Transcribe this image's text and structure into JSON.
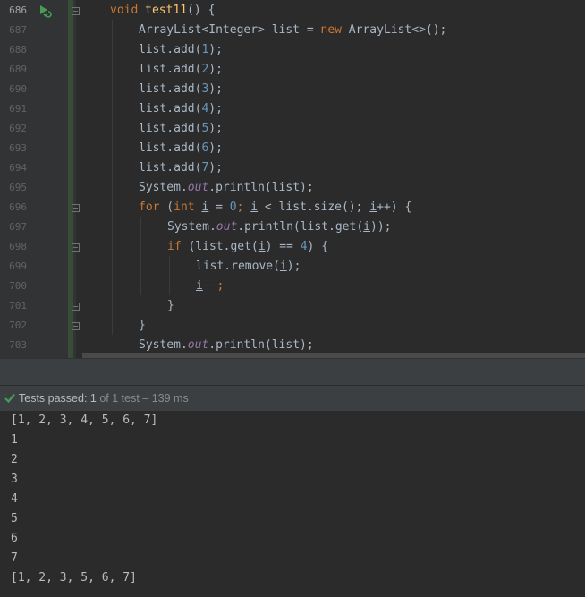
{
  "editor": {
    "line_numbers": [
      "686",
      "687",
      "688",
      "689",
      "690",
      "691",
      "692",
      "693",
      "694",
      "695",
      "696",
      "697",
      "698",
      "699",
      "700",
      "701",
      "702",
      "703"
    ],
    "code": {
      "l686": {
        "void": "void",
        "name": "test11",
        "rest": "() {"
      },
      "l687": {
        "type": "ArrayList<Integer> list = ",
        "new": "new",
        "rest": " ArrayList<>();"
      },
      "l688": {
        "pre": "list.add(",
        "n": "1",
        "post": ");"
      },
      "l689": {
        "pre": "list.add(",
        "n": "2",
        "post": ");"
      },
      "l690": {
        "pre": "list.add(",
        "n": "3",
        "post": ");"
      },
      "l691": {
        "pre": "list.add(",
        "n": "4",
        "post": ");"
      },
      "l692": {
        "pre": "list.add(",
        "n": "5",
        "post": ");"
      },
      "l693": {
        "pre": "list.add(",
        "n": "6",
        "post": ");"
      },
      "l694": {
        "pre": "list.add(",
        "n": "7",
        "post": ");"
      },
      "l695": {
        "pre": "System.",
        "out": "out",
        "post": ".println(list);"
      },
      "l696": {
        "for": "for",
        "a": " (",
        "int": "int",
        "sp": " ",
        "i1": "i",
        "b": " = ",
        "zero": "0",
        "c": "; ",
        "i2": "i",
        "d": " < list.size(); ",
        "i3": "i",
        "e": "++) {"
      },
      "l697": {
        "pre": "System.",
        "out": "out",
        "mid": ".println(list.get(",
        "i": "i",
        "post": "));"
      },
      "l698": {
        "if": "if",
        "a": " (list.get(",
        "i": "i",
        "b": ") == ",
        "four": "4",
        "c": ") {"
      },
      "l699": {
        "pre": "list.remove(",
        "i": "i",
        "post": ");"
      },
      "l700": {
        "i": "i",
        "post": "--;"
      },
      "l701": {
        "brace": "}"
      },
      "l702": {
        "brace": "}"
      },
      "l703": {
        "pre": "System.",
        "out": "out",
        "post": ".println(list);"
      }
    }
  },
  "results": {
    "status_label": "Tests passed:",
    "count": "1",
    "detail": "of 1 test – 139 ms"
  },
  "console": {
    "lines": [
      "[1, 2, 3, 4, 5, 6, 7]",
      "1",
      "2",
      "3",
      "4",
      "5",
      "6",
      "7",
      "[1, 2, 3, 5, 6, 7]"
    ]
  },
  "colors": {
    "keyword": "#cc7832",
    "method_decl": "#ffc66d",
    "number": "#6897bb",
    "static_field": "#9876aa",
    "default_text": "#a9b7c6",
    "pass_green": "#499c54"
  },
  "icons": {
    "run": "run-test-icon",
    "fold": "fold-marker-icon",
    "pass": "check-icon"
  }
}
